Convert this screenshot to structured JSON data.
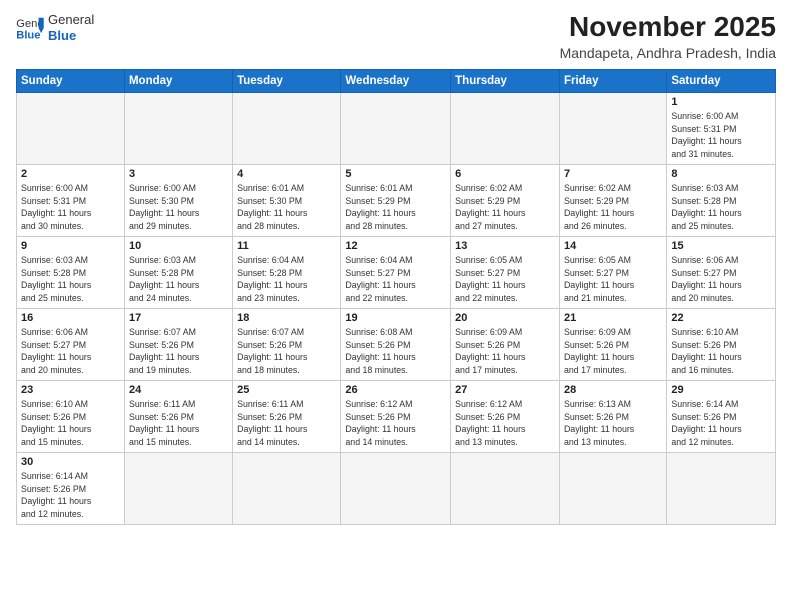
{
  "header": {
    "logo_general": "General",
    "logo_blue": "Blue",
    "month_title": "November 2025",
    "location": "Mandapeta, Andhra Pradesh, India"
  },
  "weekdays": [
    "Sunday",
    "Monday",
    "Tuesday",
    "Wednesday",
    "Thursday",
    "Friday",
    "Saturday"
  ],
  "weeks": [
    [
      {
        "day": "",
        "info": ""
      },
      {
        "day": "",
        "info": ""
      },
      {
        "day": "",
        "info": ""
      },
      {
        "day": "",
        "info": ""
      },
      {
        "day": "",
        "info": ""
      },
      {
        "day": "",
        "info": ""
      },
      {
        "day": "1",
        "info": "Sunrise: 6:00 AM\nSunset: 5:31 PM\nDaylight: 11 hours\nand 31 minutes."
      }
    ],
    [
      {
        "day": "2",
        "info": "Sunrise: 6:00 AM\nSunset: 5:31 PM\nDaylight: 11 hours\nand 30 minutes."
      },
      {
        "day": "3",
        "info": "Sunrise: 6:00 AM\nSunset: 5:30 PM\nDaylight: 11 hours\nand 29 minutes."
      },
      {
        "day": "4",
        "info": "Sunrise: 6:01 AM\nSunset: 5:30 PM\nDaylight: 11 hours\nand 28 minutes."
      },
      {
        "day": "5",
        "info": "Sunrise: 6:01 AM\nSunset: 5:29 PM\nDaylight: 11 hours\nand 28 minutes."
      },
      {
        "day": "6",
        "info": "Sunrise: 6:02 AM\nSunset: 5:29 PM\nDaylight: 11 hours\nand 27 minutes."
      },
      {
        "day": "7",
        "info": "Sunrise: 6:02 AM\nSunset: 5:29 PM\nDaylight: 11 hours\nand 26 minutes."
      },
      {
        "day": "8",
        "info": "Sunrise: 6:03 AM\nSunset: 5:28 PM\nDaylight: 11 hours\nand 25 minutes."
      }
    ],
    [
      {
        "day": "9",
        "info": "Sunrise: 6:03 AM\nSunset: 5:28 PM\nDaylight: 11 hours\nand 25 minutes."
      },
      {
        "day": "10",
        "info": "Sunrise: 6:03 AM\nSunset: 5:28 PM\nDaylight: 11 hours\nand 24 minutes."
      },
      {
        "day": "11",
        "info": "Sunrise: 6:04 AM\nSunset: 5:28 PM\nDaylight: 11 hours\nand 23 minutes."
      },
      {
        "day": "12",
        "info": "Sunrise: 6:04 AM\nSunset: 5:27 PM\nDaylight: 11 hours\nand 22 minutes."
      },
      {
        "day": "13",
        "info": "Sunrise: 6:05 AM\nSunset: 5:27 PM\nDaylight: 11 hours\nand 22 minutes."
      },
      {
        "day": "14",
        "info": "Sunrise: 6:05 AM\nSunset: 5:27 PM\nDaylight: 11 hours\nand 21 minutes."
      },
      {
        "day": "15",
        "info": "Sunrise: 6:06 AM\nSunset: 5:27 PM\nDaylight: 11 hours\nand 20 minutes."
      }
    ],
    [
      {
        "day": "16",
        "info": "Sunrise: 6:06 AM\nSunset: 5:27 PM\nDaylight: 11 hours\nand 20 minutes."
      },
      {
        "day": "17",
        "info": "Sunrise: 6:07 AM\nSunset: 5:26 PM\nDaylight: 11 hours\nand 19 minutes."
      },
      {
        "day": "18",
        "info": "Sunrise: 6:07 AM\nSunset: 5:26 PM\nDaylight: 11 hours\nand 18 minutes."
      },
      {
        "day": "19",
        "info": "Sunrise: 6:08 AM\nSunset: 5:26 PM\nDaylight: 11 hours\nand 18 minutes."
      },
      {
        "day": "20",
        "info": "Sunrise: 6:09 AM\nSunset: 5:26 PM\nDaylight: 11 hours\nand 17 minutes."
      },
      {
        "day": "21",
        "info": "Sunrise: 6:09 AM\nSunset: 5:26 PM\nDaylight: 11 hours\nand 17 minutes."
      },
      {
        "day": "22",
        "info": "Sunrise: 6:10 AM\nSunset: 5:26 PM\nDaylight: 11 hours\nand 16 minutes."
      }
    ],
    [
      {
        "day": "23",
        "info": "Sunrise: 6:10 AM\nSunset: 5:26 PM\nDaylight: 11 hours\nand 15 minutes."
      },
      {
        "day": "24",
        "info": "Sunrise: 6:11 AM\nSunset: 5:26 PM\nDaylight: 11 hours\nand 15 minutes."
      },
      {
        "day": "25",
        "info": "Sunrise: 6:11 AM\nSunset: 5:26 PM\nDaylight: 11 hours\nand 14 minutes."
      },
      {
        "day": "26",
        "info": "Sunrise: 6:12 AM\nSunset: 5:26 PM\nDaylight: 11 hours\nand 14 minutes."
      },
      {
        "day": "27",
        "info": "Sunrise: 6:12 AM\nSunset: 5:26 PM\nDaylight: 11 hours\nand 13 minutes."
      },
      {
        "day": "28",
        "info": "Sunrise: 6:13 AM\nSunset: 5:26 PM\nDaylight: 11 hours\nand 13 minutes."
      },
      {
        "day": "29",
        "info": "Sunrise: 6:14 AM\nSunset: 5:26 PM\nDaylight: 11 hours\nand 12 minutes."
      }
    ],
    [
      {
        "day": "30",
        "info": "Sunrise: 6:14 AM\nSunset: 5:26 PM\nDaylight: 11 hours\nand 12 minutes."
      },
      {
        "day": "",
        "info": ""
      },
      {
        "day": "",
        "info": ""
      },
      {
        "day": "",
        "info": ""
      },
      {
        "day": "",
        "info": ""
      },
      {
        "day": "",
        "info": ""
      },
      {
        "day": "",
        "info": ""
      }
    ]
  ]
}
